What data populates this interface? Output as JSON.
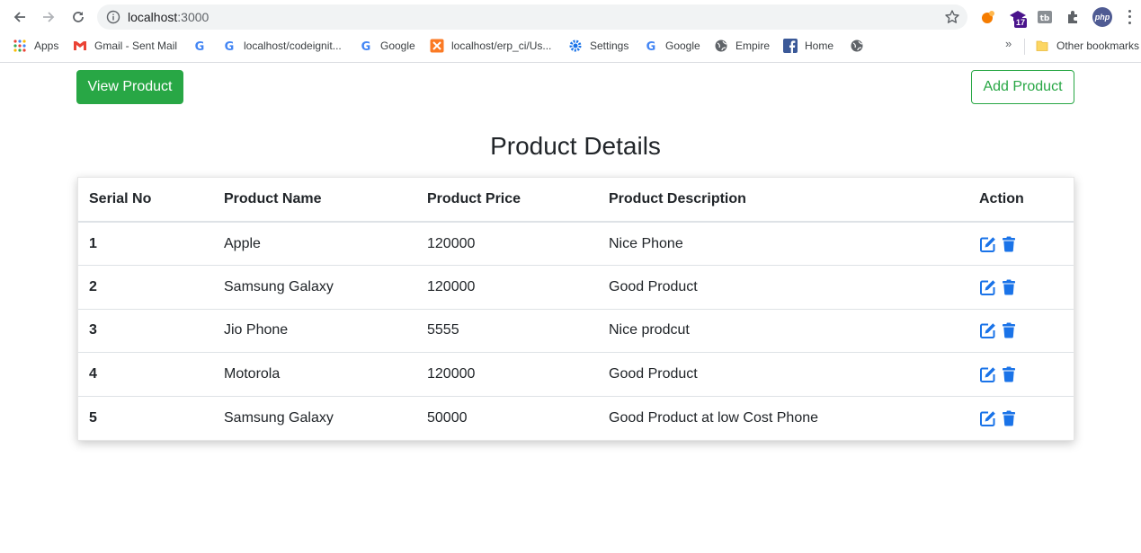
{
  "browser": {
    "url_host": "localhost",
    "url_port": ":3000",
    "ext_badge_count": "17",
    "php_label": "php",
    "bookmarks": [
      {
        "label": "Apps",
        "icon": "apps-grid-icon"
      },
      {
        "label": "Gmail - Sent Mail",
        "icon": "gmail-icon"
      },
      {
        "label": "",
        "icon": "google-icon"
      },
      {
        "label": "localhost/codeignit...",
        "icon": "google-icon"
      },
      {
        "label": "Google",
        "icon": "google-icon"
      },
      {
        "label": "localhost/erp_ci/Us...",
        "icon": "xampp-icon"
      },
      {
        "label": "Settings",
        "icon": "settings-gear-icon"
      },
      {
        "label": "Google",
        "icon": "google-icon"
      },
      {
        "label": "Empire",
        "icon": "globe-icon"
      },
      {
        "label": "Home",
        "icon": "facebook-icon"
      },
      {
        "label": "",
        "icon": "globe-icon"
      }
    ],
    "bookmarks_overflow": "»",
    "other_bookmarks": "Other bookmarks"
  },
  "page": {
    "view_button": "View Product",
    "add_button": "Add Product",
    "title": "Product Details",
    "table": {
      "headers": [
        "Serial No",
        "Product Name",
        "Product Price",
        "Product Description",
        "Action"
      ],
      "rows": [
        {
          "serial": "1",
          "name": "Apple",
          "price": "120000",
          "description": "Nice Phone"
        },
        {
          "serial": "2",
          "name": "Samsung Galaxy",
          "price": "120000",
          "description": "Good Product"
        },
        {
          "serial": "3",
          "name": "Jio Phone",
          "price": "5555",
          "description": "Nice prodcut"
        },
        {
          "serial": "4",
          "name": "Motorola",
          "price": "120000",
          "description": "Good Product"
        },
        {
          "serial": "5",
          "name": "Samsung Galaxy",
          "price": "50000",
          "description": "Good Product at low Cost Phone"
        }
      ]
    }
  },
  "colors": {
    "primary_green": "#28a745",
    "action_blue": "#1a73e8"
  }
}
